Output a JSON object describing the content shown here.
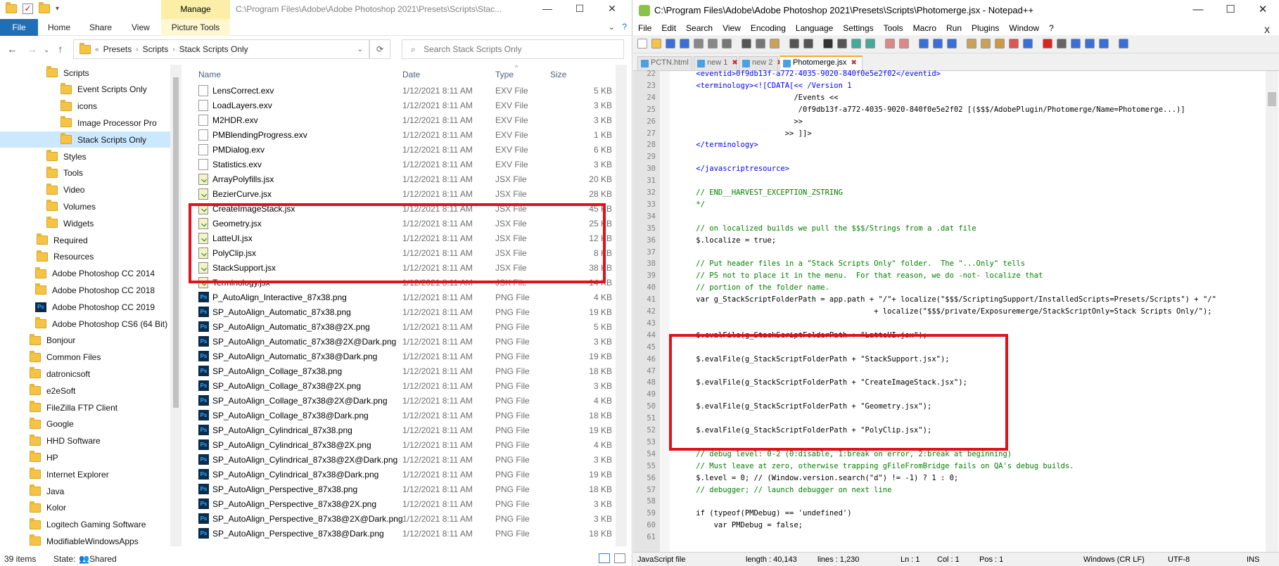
{
  "explorer": {
    "title_path": "C:\\Program Files\\Adobe\\Adobe Photoshop 2021\\Presets\\Scripts\\Stac...",
    "manage_tab": "Manage",
    "ribbon": {
      "file": "File",
      "home": "Home",
      "share": "Share",
      "view": "View",
      "picture_tools": "Picture Tools"
    },
    "breadcrumb": {
      "prefix": "«",
      "items": [
        "Presets",
        "Scripts",
        "Stack Scripts Only"
      ]
    },
    "search_placeholder": "Search Stack Scripts Only",
    "nav": [
      {
        "label": "Scripts",
        "indent": 1
      },
      {
        "label": "Event Scripts Only",
        "indent": 2
      },
      {
        "label": "icons",
        "indent": 2
      },
      {
        "label": "Image Processor Pro",
        "indent": 2
      },
      {
        "label": "Stack Scripts Only",
        "indent": 2,
        "selected": true
      },
      {
        "label": "Styles",
        "indent": 1
      },
      {
        "label": "Tools",
        "indent": 1
      },
      {
        "label": "Video",
        "indent": 1
      },
      {
        "label": "Volumes",
        "indent": 1
      },
      {
        "label": "Widgets",
        "indent": 1
      },
      {
        "label": "Required",
        "indent": 0
      },
      {
        "label": "Resources",
        "indent": 0
      },
      {
        "label": "Adobe Photoshop CC 2014",
        "indent": -1
      },
      {
        "label": "Adobe Photoshop CC 2018",
        "indent": -1
      },
      {
        "label": "Adobe Photoshop CC 2019",
        "indent": -1,
        "ps": true
      },
      {
        "label": "Adobe Photoshop CS6 (64 Bit)",
        "indent": -1
      },
      {
        "label": "Bonjour",
        "indent": -2
      },
      {
        "label": "Common Files",
        "indent": -2
      },
      {
        "label": "datronicsoft",
        "indent": -2
      },
      {
        "label": "e2eSoft",
        "indent": -2
      },
      {
        "label": "FileZilla FTP Client",
        "indent": -2
      },
      {
        "label": "Google",
        "indent": -2
      },
      {
        "label": "HHD Software",
        "indent": -2
      },
      {
        "label": "HP",
        "indent": -2
      },
      {
        "label": "Internet Explorer",
        "indent": -2
      },
      {
        "label": "Java",
        "indent": -2
      },
      {
        "label": "Kolor",
        "indent": -2
      },
      {
        "label": "Logitech Gaming Software",
        "indent": -2
      },
      {
        "label": "ModifiableWindowsApps",
        "indent": -2
      }
    ],
    "columns": {
      "name": "Name",
      "date": "Date",
      "type": "Type",
      "size": "Size"
    },
    "files": [
      {
        "name": "LensCorrect.exv",
        "date": "1/12/2021 8:11 AM",
        "type": "EXV File",
        "size": "5 KB",
        "icon": "exv"
      },
      {
        "name": "LoadLayers.exv",
        "date": "1/12/2021 8:11 AM",
        "type": "EXV File",
        "size": "3 KB",
        "icon": "exv"
      },
      {
        "name": "M2HDR.exv",
        "date": "1/12/2021 8:11 AM",
        "type": "EXV File",
        "size": "3 KB",
        "icon": "exv"
      },
      {
        "name": "PMBlendingProgress.exv",
        "date": "1/12/2021 8:11 AM",
        "type": "EXV File",
        "size": "1 KB",
        "icon": "exv"
      },
      {
        "name": "PMDialog.exv",
        "date": "1/12/2021 8:11 AM",
        "type": "EXV File",
        "size": "6 KB",
        "icon": "exv"
      },
      {
        "name": "Statistics.exv",
        "date": "1/12/2021 8:11 AM",
        "type": "EXV File",
        "size": "3 KB",
        "icon": "exv"
      },
      {
        "name": "ArrayPolyfills.jsx",
        "date": "1/12/2021 8:11 AM",
        "type": "JSX File",
        "size": "20 KB",
        "icon": "jsx"
      },
      {
        "name": "BezierCurve.jsx",
        "date": "1/12/2021 8:11 AM",
        "type": "JSX File",
        "size": "28 KB",
        "icon": "jsx"
      },
      {
        "name": "CreateImageStack.jsx",
        "date": "1/12/2021 8:11 AM",
        "type": "JSX File",
        "size": "45 KB",
        "icon": "jsx"
      },
      {
        "name": "Geometry.jsx",
        "date": "1/12/2021 8:11 AM",
        "type": "JSX File",
        "size": "25 KB",
        "icon": "jsx"
      },
      {
        "name": "LatteUI.jsx",
        "date": "1/12/2021 8:11 AM",
        "type": "JSX File",
        "size": "12 KB",
        "icon": "jsx"
      },
      {
        "name": "PolyClip.jsx",
        "date": "1/12/2021 8:11 AM",
        "type": "JSX File",
        "size": "8 KB",
        "icon": "jsx"
      },
      {
        "name": "StackSupport.jsx",
        "date": "1/12/2021 8:11 AM",
        "type": "JSX File",
        "size": "38 KB",
        "icon": "jsx"
      },
      {
        "name": "Terminology.jsx",
        "date": "1/12/2021 8:11 AM",
        "type": "JSX File",
        "size": "14 KB",
        "icon": "jsx"
      },
      {
        "name": "P_AutoAlign_Interactive_87x38.png",
        "date": "1/12/2021 8:11 AM",
        "type": "PNG File",
        "size": "4 KB",
        "icon": "png"
      },
      {
        "name": "SP_AutoAlign_Automatic_87x38.png",
        "date": "1/12/2021 8:11 AM",
        "type": "PNG File",
        "size": "19 KB",
        "icon": "png"
      },
      {
        "name": "SP_AutoAlign_Automatic_87x38@2X.png",
        "date": "1/12/2021 8:11 AM",
        "type": "PNG File",
        "size": "5 KB",
        "icon": "png"
      },
      {
        "name": "SP_AutoAlign_Automatic_87x38@2X@Dark.png",
        "date": "1/12/2021 8:11 AM",
        "type": "PNG File",
        "size": "3 KB",
        "icon": "png"
      },
      {
        "name": "SP_AutoAlign_Automatic_87x38@Dark.png",
        "date": "1/12/2021 8:11 AM",
        "type": "PNG File",
        "size": "19 KB",
        "icon": "png"
      },
      {
        "name": "SP_AutoAlign_Collage_87x38.png",
        "date": "1/12/2021 8:11 AM",
        "type": "PNG File",
        "size": "18 KB",
        "icon": "png"
      },
      {
        "name": "SP_AutoAlign_Collage_87x38@2X.png",
        "date": "1/12/2021 8:11 AM",
        "type": "PNG File",
        "size": "3 KB",
        "icon": "png"
      },
      {
        "name": "SP_AutoAlign_Collage_87x38@2X@Dark.png",
        "date": "1/12/2021 8:11 AM",
        "type": "PNG File",
        "size": "4 KB",
        "icon": "png"
      },
      {
        "name": "SP_AutoAlign_Collage_87x38@Dark.png",
        "date": "1/12/2021 8:11 AM",
        "type": "PNG File",
        "size": "18 KB",
        "icon": "png"
      },
      {
        "name": "SP_AutoAlign_Cylindrical_87x38.png",
        "date": "1/12/2021 8:11 AM",
        "type": "PNG File",
        "size": "19 KB",
        "icon": "png"
      },
      {
        "name": "SP_AutoAlign_Cylindrical_87x38@2X.png",
        "date": "1/12/2021 8:11 AM",
        "type": "PNG File",
        "size": "4 KB",
        "icon": "png"
      },
      {
        "name": "SP_AutoAlign_Cylindrical_87x38@2X@Dark.png",
        "date": "1/12/2021 8:11 AM",
        "type": "PNG File",
        "size": "3 KB",
        "icon": "png"
      },
      {
        "name": "SP_AutoAlign_Cylindrical_87x38@Dark.png",
        "date": "1/12/2021 8:11 AM",
        "type": "PNG File",
        "size": "19 KB",
        "icon": "png"
      },
      {
        "name": "SP_AutoAlign_Perspective_87x38.png",
        "date": "1/12/2021 8:11 AM",
        "type": "PNG File",
        "size": "18 KB",
        "icon": "png"
      },
      {
        "name": "SP_AutoAlign_Perspective_87x38@2X.png",
        "date": "1/12/2021 8:11 AM",
        "type": "PNG File",
        "size": "3 KB",
        "icon": "png"
      },
      {
        "name": "SP_AutoAlign_Perspective_87x38@2X@Dark.png",
        "date": "1/12/2021 8:11 AM",
        "type": "PNG File",
        "size": "3 KB",
        "icon": "png"
      },
      {
        "name": "SP_AutoAlign_Perspective_87x38@Dark.png",
        "date": "1/12/2021 8:11 AM",
        "type": "PNG File",
        "size": "18 KB",
        "icon": "png"
      }
    ],
    "status": {
      "items": "39 items",
      "state_label": "State:",
      "state_value": "Shared"
    }
  },
  "notepad": {
    "title": "C:\\Program Files\\Adobe\\Adobe Photoshop 2021\\Presets\\Scripts\\Photomerge.jsx - Notepad++",
    "menu": [
      "File",
      "Edit",
      "Search",
      "View",
      "Encoding",
      "Language",
      "Settings",
      "Tools",
      "Macro",
      "Run",
      "Plugins",
      "Window",
      "?"
    ],
    "close_x": "X",
    "tabs": [
      {
        "label": "PCTN.html",
        "active": false
      },
      {
        "label": "new 1",
        "active": false
      },
      {
        "label": "new 2",
        "active": false
      },
      {
        "label": "Photomerge.jsx",
        "active": true
      }
    ],
    "lines": [
      {
        "n": "22",
        "t": "    <eventid>0f9db13f-a772-4035-9020-840f0e5e2f02</eventid>",
        "c": "tag"
      },
      {
        "n": "23",
        "t": "    <terminology><![CDATA[<< /Version 1",
        "c": "tag"
      },
      {
        "n": "24",
        "t": "                          /Events <<",
        "c": ""
      },
      {
        "n": "25",
        "t": "                           /0f9db13f-a772-4035-9020-840f0e5e2f02 [($$$/AdobePlugin/Photomerge/Name=Photomerge...)]",
        "c": ""
      },
      {
        "n": "26",
        "t": "                          >>",
        "c": ""
      },
      {
        "n": "27",
        "t": "                        >> ]]>",
        "c": ""
      },
      {
        "n": "28",
        "t": "    </terminology>",
        "c": "tag"
      },
      {
        "n": "29",
        "t": "",
        "c": ""
      },
      {
        "n": "30",
        "t": "    </javascriptresource>",
        "c": "tag"
      },
      {
        "n": "31",
        "t": "",
        "c": ""
      },
      {
        "n": "32",
        "t": "    // END__HARVEST_EXCEPTION_ZSTRING",
        "c": "cmt"
      },
      {
        "n": "33",
        "t": "    */",
        "c": "cmt"
      },
      {
        "n": "34",
        "t": "",
        "c": ""
      },
      {
        "n": "35",
        "t": "    // on localized builds we pull the $$$/Strings from a .dat file",
        "c": "cmt"
      },
      {
        "n": "36",
        "t": "    $.localize = true;",
        "c": ""
      },
      {
        "n": "37",
        "t": "",
        "c": ""
      },
      {
        "n": "38",
        "t": "    // Put header files in a \"Stack Scripts Only\" folder.  The \"...Only\" tells",
        "c": "cmt"
      },
      {
        "n": "39",
        "t": "    // PS not to place it in the menu.  For that reason, we do -not- localize that",
        "c": "cmt"
      },
      {
        "n": "40",
        "t": "    // portion of the folder name.",
        "c": "cmt"
      },
      {
        "n": "41",
        "t": "    var g_StackScriptFolderPath = app.path + \"/\"+ localize(\"$$$/ScriptingSupport/InstalledScripts=Presets/Scripts\") + \"/\"",
        "c": ""
      },
      {
        "n": "42",
        "t": "                                            + localize(\"$$$/private/Exposuremerge/StackScriptOnly=Stack Scripts Only/\");",
        "c": ""
      },
      {
        "n": "43",
        "t": "",
        "c": ""
      },
      {
        "n": "44",
        "t": "    $.evalFile(g_StackScriptFolderPath + \"LatteUI.jsx\");",
        "c": ""
      },
      {
        "n": "45",
        "t": "",
        "c": ""
      },
      {
        "n": "46",
        "t": "    $.evalFile(g_StackScriptFolderPath + \"StackSupport.jsx\");",
        "c": ""
      },
      {
        "n": "47",
        "t": "",
        "c": ""
      },
      {
        "n": "48",
        "t": "    $.evalFile(g_StackScriptFolderPath + \"CreateImageStack.jsx\");",
        "c": ""
      },
      {
        "n": "49",
        "t": "",
        "c": ""
      },
      {
        "n": "50",
        "t": "    $.evalFile(g_StackScriptFolderPath + \"Geometry.jsx\");",
        "c": ""
      },
      {
        "n": "51",
        "t": "",
        "c": ""
      },
      {
        "n": "52",
        "t": "    $.evalFile(g_StackScriptFolderPath + \"PolyClip.jsx\");",
        "c": ""
      },
      {
        "n": "53",
        "t": "",
        "c": ""
      },
      {
        "n": "54",
        "t": "    // debug level: 0-2 (0:disable, 1:break on error, 2:break at beginning)",
        "c": "cmt"
      },
      {
        "n": "55",
        "t": "    // Must leave at zero, otherwise trapping gFileFromBridge fails on QA's debug builds.",
        "c": "cmt"
      },
      {
        "n": "56",
        "t": "    $.level = 0; // (Window.version.search(\"d\") != -1) ? 1 : 0;",
        "c": ""
      },
      {
        "n": "57",
        "t": "    // debugger; // launch debugger on next line",
        "c": "cmt"
      },
      {
        "n": "58",
        "t": "",
        "c": ""
      },
      {
        "n": "59",
        "t": "    if (typeof(PMDebug) == 'undefined')",
        "c": ""
      },
      {
        "n": "60",
        "t": "        var PMDebug = false;",
        "c": ""
      },
      {
        "n": "61",
        "t": "",
        "c": ""
      }
    ],
    "status": {
      "lang": "JavaScript file",
      "length": "length : 40,143",
      "lines": "lines : 1,230",
      "ln": "Ln : 1",
      "col": "Col : 1",
      "pos": "Pos : 1",
      "eol": "Windows (CR LF)",
      "enc": "UTF-8",
      "ins": "INS"
    }
  },
  "colors": {
    "highlight_box": "#e0121a",
    "selected_nav": "#cce8ff",
    "file_tab": "#1e6fb7",
    "manage_tab": "#fbefa8"
  }
}
